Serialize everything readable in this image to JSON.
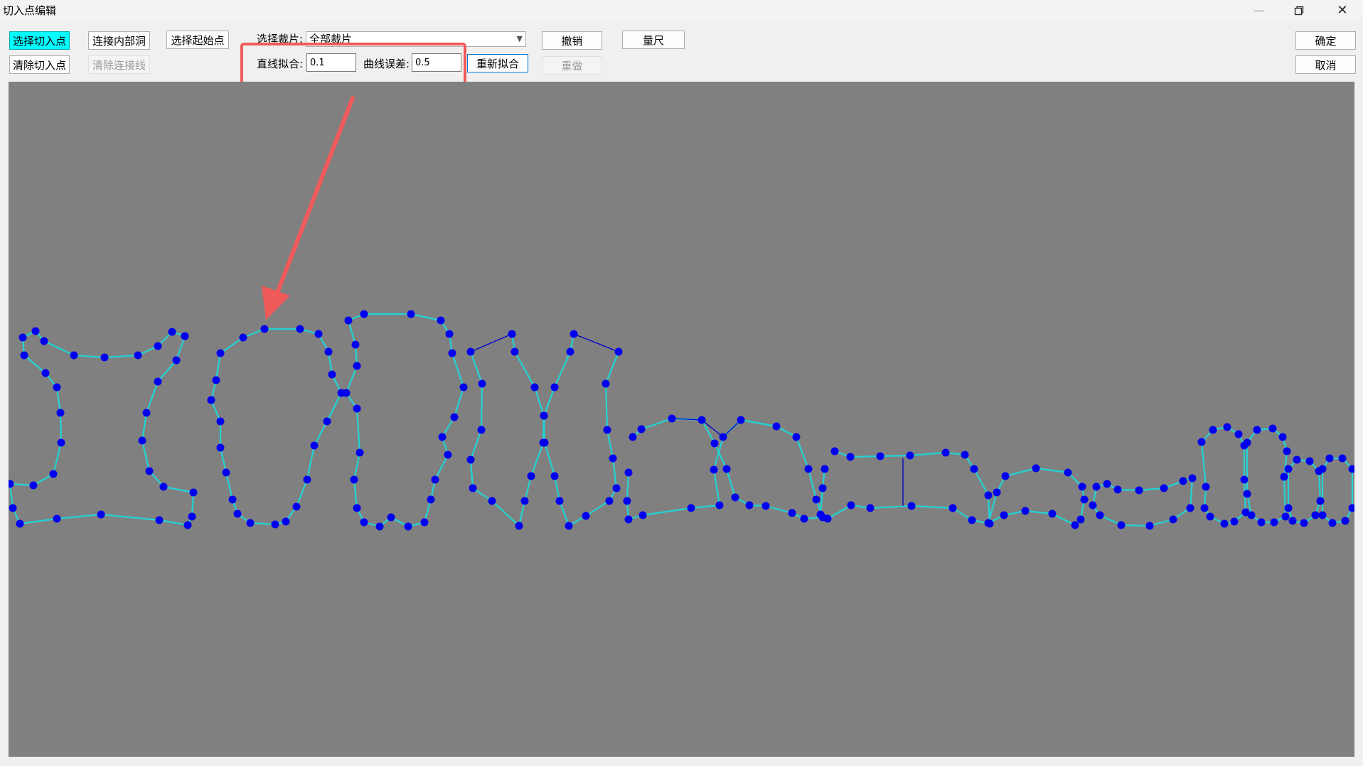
{
  "window": {
    "title": "切入点编辑"
  },
  "toolbar": {
    "select_cut_point": "选择切入点",
    "clear_cut_point": "清除切入点",
    "connect_inner_hole": "连接内部洞",
    "clear_connect_line": "清除连接线",
    "select_start_point": "选择起始点",
    "select_piece_label": "选择裁片:",
    "select_piece_value": "全部裁片",
    "line_fit_label": "直线拟合:",
    "line_fit_value": "0.1",
    "curve_error_label": "曲线误差:",
    "curve_error_value": "0.5",
    "refit": "重新拟合",
    "undo": "撤销",
    "redo": "重做",
    "ruler": "量尺",
    "ok": "确定",
    "cancel": "取消"
  },
  "colors": {
    "active_button": "#00ffff",
    "canvas_bg": "#808080",
    "curve": "#22d3d3",
    "point": "#0000ee",
    "line": "#0000cc",
    "annotation": "#f05a5a"
  },
  "icons": {
    "minimize": "minimize-icon",
    "restore": "restore-icon",
    "close": "close-icon",
    "dropdown": "chevron-down-icon"
  }
}
